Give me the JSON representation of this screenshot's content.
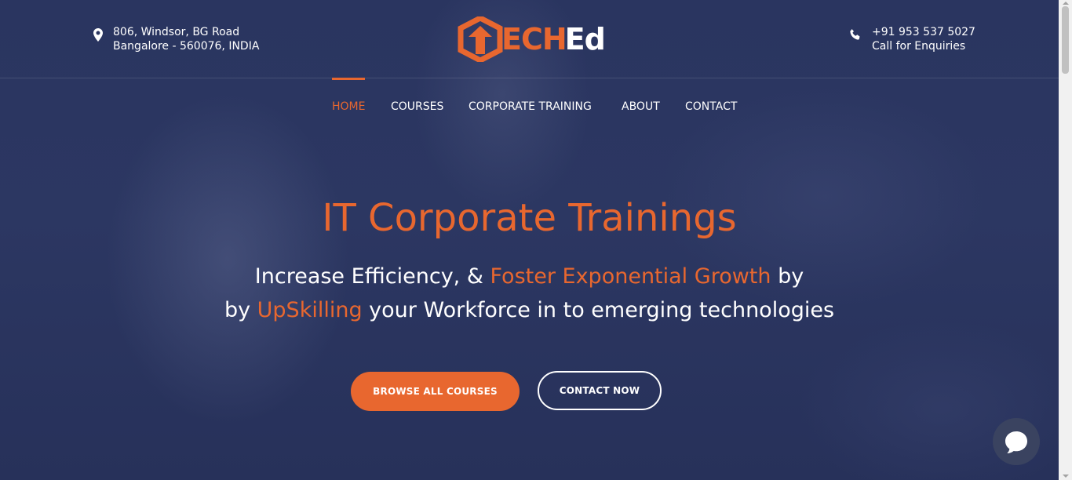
{
  "header": {
    "address_line1": "806, Windsor, BG Road",
    "address_line2": "Bangalore - 560076, INDIA",
    "phone": "+91 953 537 5027",
    "phone_caption": "Call for Enquiries",
    "logo_text_accent": "ECH",
    "logo_text_rest": "Ed"
  },
  "nav": {
    "items": [
      {
        "label": "HOME",
        "active": true
      },
      {
        "label": "COURSES",
        "active": false
      },
      {
        "label": "CORPORATE TRAINING",
        "active": false
      },
      {
        "label": "ABOUT",
        "active": false
      },
      {
        "label": "CONTACT",
        "active": false
      }
    ]
  },
  "hero": {
    "title": "IT Corporate Trainings",
    "line1_a": "Increase Efficiency, & ",
    "line1_highlight": "Foster Exponential Growth",
    "line1_b": " by",
    "line2_a": "by ",
    "line2_highlight": "UpSkilling",
    "line2_b": " your Workforce in to emerging technologies",
    "btn_primary": "BROWSE ALL COURSES",
    "btn_secondary": "CONTACT NOW"
  },
  "icons": {
    "address": "map-pin-icon",
    "phone": "phone-icon",
    "chat": "chat-bubble-icon"
  },
  "colors": {
    "accent": "#e8672f",
    "hero_bg": "#2b3660",
    "chat_bg": "#3a4360"
  }
}
